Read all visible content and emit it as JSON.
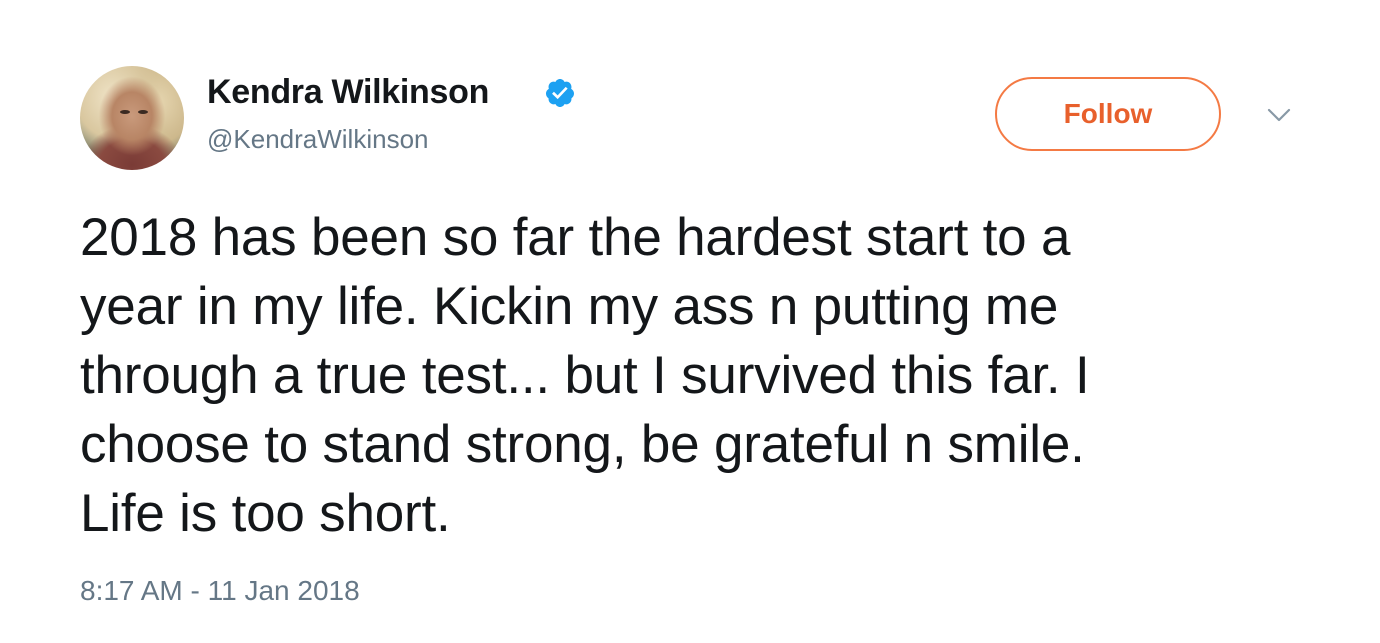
{
  "user": {
    "display_name": "Kendra Wilkinson",
    "handle": "@KendraWilkinson",
    "verified": true,
    "avatar_icon": "avatar-photo"
  },
  "actions": {
    "follow_label": "Follow",
    "menu_icon": "chevron-down-icon"
  },
  "tweet": {
    "lines": [
      "2018 has been so far the hardest start to a",
      "year in my life. Kickin my ass n putting me",
      "through a true test... but I survived this far. I",
      "choose to stand strong, be grateful n smile.",
      "Life is too short."
    ],
    "timestamp": "8:17 AM - 11 Jan 2018"
  },
  "colors": {
    "accent": "#f47a44",
    "verified": "#1da1f2",
    "secondary_text": "#657786",
    "primary_text": "#14171a"
  }
}
